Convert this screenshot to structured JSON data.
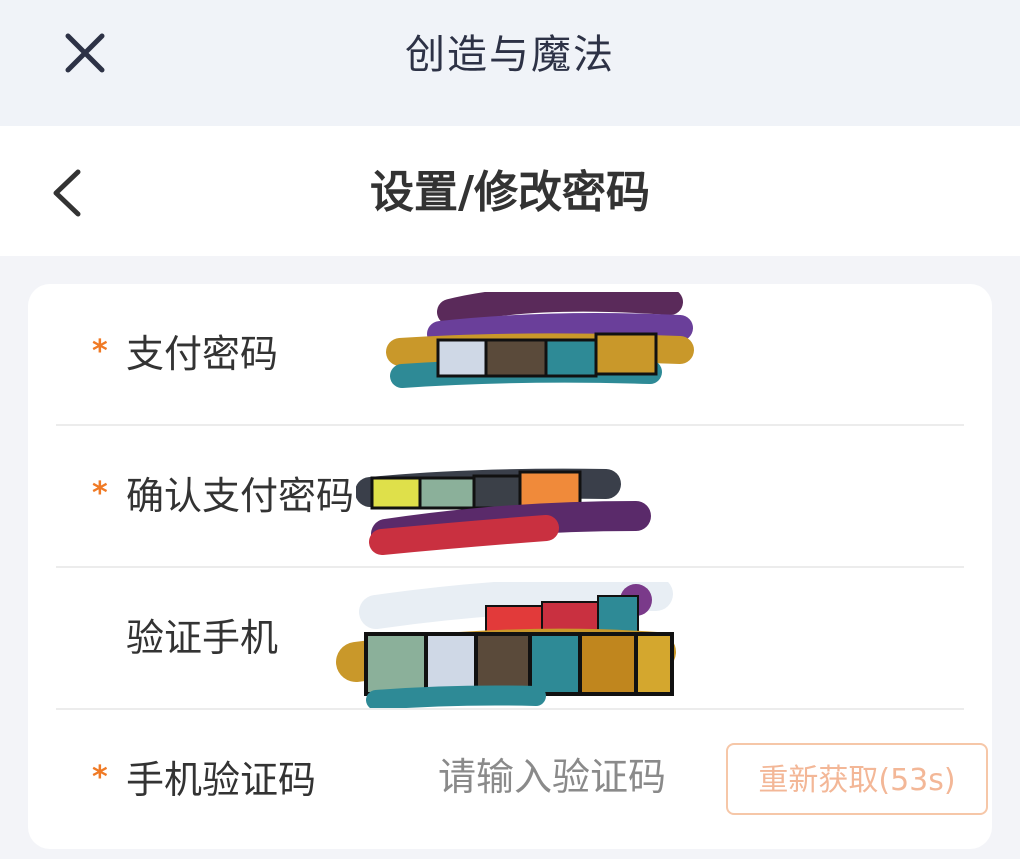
{
  "topbar": {
    "title": "创造与魔法",
    "close_icon": "close-icon"
  },
  "navbar": {
    "title": "设置/修改密码",
    "back_icon": "chevron-left-icon"
  },
  "form": {
    "rows": [
      {
        "required": true,
        "required_mark": "*",
        "label": "支付密码"
      },
      {
        "required": true,
        "required_mark": "*",
        "label": "确认支付密码"
      },
      {
        "required": false,
        "required_mark": "",
        "label": "验证手机"
      },
      {
        "required": true,
        "required_mark": "*",
        "label": "手机验证码",
        "placeholder": "请输入验证码"
      }
    ],
    "resend_button": "重新获取(53s)"
  },
  "colors": {
    "accent": "#f07a25",
    "button_border": "#f6c7a8",
    "button_text": "#f3b797",
    "title_text": "#2d3246"
  }
}
